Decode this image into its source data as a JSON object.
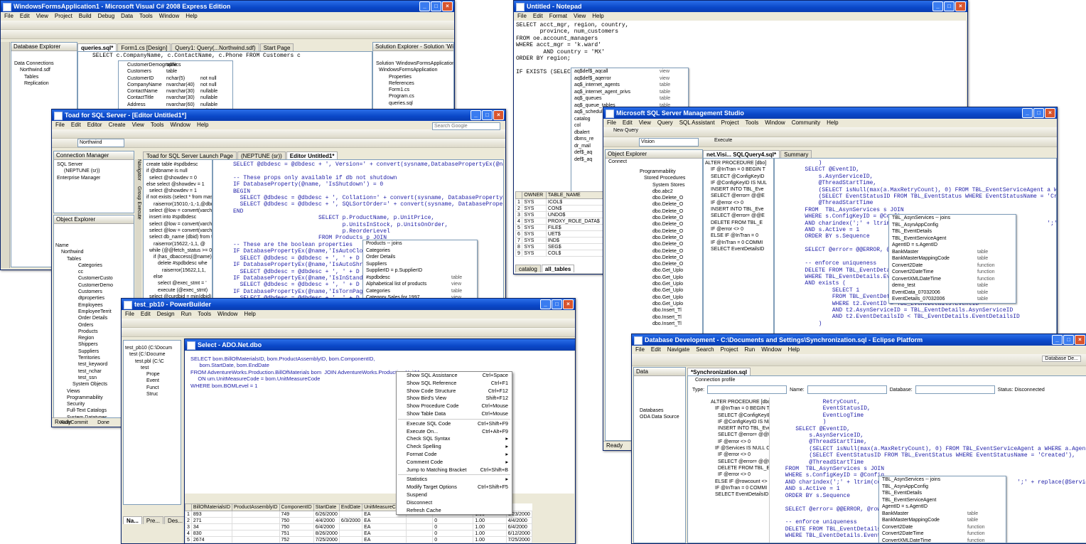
{
  "vs": {
    "title": "WindowsFormsApplication1 - Microsoft Visual C# 2008 Express Edition",
    "menu": [
      "File",
      "Edit",
      "View",
      "Project",
      "Build",
      "Debug",
      "Data",
      "Tools",
      "Window",
      "Help"
    ],
    "db_explorer": {
      "title": "Database Explorer",
      "items": [
        "Data Connections",
        "Northwind.sdf",
        "Tables",
        "Replication"
      ]
    },
    "tabs": [
      "queries.sql*",
      "Form1.cs [Design]",
      "Query1: Query(...Northwind.sdf)",
      "Start Page"
    ],
    "sql": "SELECT c.CompanyName, c.ContactName, c.Phone FROM Customers c",
    "columns": [
      [
        "CustomerDemographics",
        "table"
      ],
      [
        "Customers",
        "table"
      ],
      [
        "CustomerID",
        "nchar(5)",
        "not null"
      ],
      [
        "CompanyName",
        "nvarchar(40)",
        "not null"
      ],
      [
        "ContactName",
        "nvarchar(30)",
        "nullable"
      ],
      [
        "ContactTitle",
        "nvarchar(30)",
        "nullable"
      ],
      [
        "Address",
        "nvarchar(60)",
        "nullable"
      ],
      [
        "City",
        "nvarchar(15)",
        "nullable"
      ]
    ],
    "solution_explorer": {
      "title": "Solution Explorer - Solution 'WindowsFormsApplication1'",
      "items": [
        "Solution 'WindowsFormsApplication'",
        "WindowsFormsApplication",
        "Properties",
        "References",
        "Form1.cs",
        "Program.cs",
        "queries.sql"
      ]
    }
  },
  "notepad": {
    "title": "Untitled - Notepad",
    "menu": [
      "File",
      "Edit",
      "Format",
      "View",
      "Help"
    ],
    "text": "SELECT acct_mgr, region, country,\n       province, num_customers\nFROM oe.account_managers\nWHERE acct_mgr = 'k.ward'\n        AND country = 'MX'\nORDER BY region;\n\nIF EXISTS (SELECT",
    "popup": [
      [
        "aq$def$_aqcall",
        "view"
      ],
      [
        "aq$def$_aqerror",
        "view"
      ],
      [
        "aq$_internet_agents",
        "table"
      ],
      [
        "aq$_internet_agent_privs",
        "table"
      ],
      [
        "aq$_queues",
        "table"
      ],
      [
        "aq$_queue_tables",
        "table"
      ],
      [
        "aq$_schedules",
        "table"
      ],
      [
        "catalog",
        "table"
      ],
      [
        "col",
        "view"
      ],
      [
        "dbalert",
        "view"
      ],
      [
        "dbms_re",
        "view"
      ],
      [
        "dr_mail",
        "view"
      ],
      [
        "def$_aq",
        "view"
      ],
      [
        "def$_aq",
        "view"
      ]
    ],
    "grid_headers": [
      "OWNER",
      "TABLE_NAME"
    ],
    "grid_rows": [
      [
        "1",
        "SYS",
        "ICOL$"
      ],
      [
        "2",
        "SYS",
        "CON$"
      ],
      [
        "3",
        "SYS",
        "UNDO$"
      ],
      [
        "4",
        "SYS",
        "PROXY_ROLE_DATA$"
      ],
      [
        "5",
        "SYS",
        "FILE$"
      ],
      [
        "6",
        "SYS",
        "UET$"
      ],
      [
        "7",
        "SYS",
        "IND$"
      ],
      [
        "8",
        "SYS",
        "SEG$"
      ],
      [
        "9",
        "SYS",
        "COL$"
      ]
    ],
    "bottom_tabs": [
      "catalog",
      "all_tables"
    ]
  },
  "toad": {
    "title": "Toad for SQL Server - [Editor Untitled1*]",
    "menu": [
      "File",
      "Edit",
      "Editor",
      "Create",
      "View",
      "Tools",
      "Window",
      "Help"
    ],
    "search_placeholder": "Search Google",
    "connection_value": "Northwind",
    "conn_manager": {
      "title": "Connection Manager",
      "items": [
        "SQL Server",
        "(NEPTUNE (sr))",
        "Enterprise Manager"
      ]
    },
    "object_explorer": {
      "title": "Object Explorer",
      "items": [
        "Name",
        "Northwind",
        "Tables",
        "Categories",
        "cc",
        "CustomerCusto",
        "CustomerDemo",
        "Customers",
        "dtproperties",
        "Employees",
        "EmployeeTerrit",
        "Order Details",
        "Orders",
        "Products",
        "Region",
        "Shippers",
        "Suppliers",
        "Territories",
        "test_keyword",
        "test_nchar",
        "test_ssn",
        "System Objects",
        "Views",
        "Programmability",
        "Security",
        "Full-Text Catalogs",
        "System Datatypes",
        "pubs2"
      ]
    },
    "tabs": [
      "Toad for SQL Server Launch Page",
      "(NEPTUNE (sr))",
      "Editor Untitled1*"
    ],
    "left_code": [
      "create table #spdbdesc",
      "if @dbname is null",
      "select @showdev = 0",
      "else select @showdev = 1",
      "select @showdev = 1",
      "if not exists (select * from mas",
      "raiserror(15010,-1,-1,@dbna",
      "select @low = convert(varcha",
      "insert into #spdbdesc",
      "select @low = convert(varcha",
      "select @low = convert(varcha",
      "select db_name (dbid) from tt",
      "raiserror(15622,-1,1, @",
      "while (@@fetch_status >= 0",
      "if (has_dbaccess(@name)",
      "delete #spdbdesc whe",
      "raiserror(15622,1,1,",
      "else",
      "select @exec_stmt = '",
      "execute (@exec_stmt)",
      "select @curdbid = min(dbid) f",
      "while @curdbid IS NOT NULL"
    ],
    "code": "SELECT @dbdesc = @dbdesc + ', Version=' + convert(sysname,DatabasePropertyEx(@name,'V\n\n-- These props only available if db not shutdown\nIF DatabaseProperty(@name, 'IsShutdown') = 0\nBEGIN\n  SELECT @dbdesc = @dbdesc + ', Collation=' + convert(sysname, DatabasePropertyEx(@name\n  SELECT @dbdesc = @dbdesc + ', SQLSortOrder=' + convert(sysname, DatabasePropertyEx(@na\nEND\n                         SELECT p.ProductName, p.UnitPrice,\n                                p.UnitsInStock, p.UnitsOnOrder,\n                                p.ReorderLevel\n                         FROM Products p JOIN\n-- These are the boolean properties\nIF DatabasePropertyEx(@name,'IsAutoClo\n  SELECT @dbdesc = @dbdesc + ', ' + D\nIF DatabasePropertyEx(@name,'IsAutoShr\n  SELECT @dbdesc = @dbdesc + ', ' + D\nIF DatabasePropertyEx(@name,'IsInStand\n  SELECT @dbdesc = @dbdesc + ', ' + D\nIF DatabasePropertyEx(@name,'IsTornPag\n  SELECT @dbdesc = @dbdesc + ', ' + D",
    "popup": [
      [
        "Products -- joins",
        ""
      ],
      [
        "Categories",
        ""
      ],
      [
        "Order Details",
        ""
      ],
      [
        "Suppliers",
        ""
      ],
      [
        "SupplierID = p.SupplierID",
        ""
      ],
      [
        "#spdbdesc",
        "table"
      ],
      [
        "Alphabetical list of products",
        "view"
      ],
      [
        "Categories",
        "table"
      ],
      [
        "Category Sales for 1997",
        "view"
      ]
    ],
    "status": "Ready",
    "bottom": [
      "AutoCommit",
      "Done"
    ],
    "sidebar_tabs": [
      "Navigator",
      "Group Execute"
    ]
  },
  "ssms": {
    "title": "Microsoft SQL Server Management Studio",
    "menu": [
      "File",
      "Edit",
      "View",
      "Query",
      "SQL Assistant",
      "Project",
      "Tools",
      "Window",
      "Community",
      "Help"
    ],
    "new_query": "New Query",
    "db_value": "Vision",
    "execute": "Execute",
    "obj_explorer": {
      "title": "Object Explorer",
      "connect": "Connect",
      "items": [
        "Programmability",
        "Stored Procedures",
        "System Stores",
        "dbo.abc2",
        "dbo.Delete_O",
        "dbo.Delete_O",
        "dbo.Delete_O",
        "dbo.Delete_O",
        "dbo.Delete_O",
        "dbo.Delete_O",
        "dbo.Delete_O",
        "dbo.Delete_O",
        "dbo.Delete_O",
        "dbo.Delete_O",
        "dbo.Delete_O",
        "dbo.Get_Uplo",
        "dbo.Get_Uplo",
        "dbo.Get_Uplo",
        "dbo.Get_Uplo",
        "dbo.Get_Uplo",
        "dbo.Get_Uplo",
        "dbo.Insert_Tl",
        "dbo.Insert_Tl",
        "dbo.Insert_Tl"
      ]
    },
    "tabs": [
      "net.Visi... SQLQuery4.sql*",
      "Summary"
    ],
    "outline": [
      "ALTER PROCEDURE [dbo]",
      "IF @InTran = 0 BEGIN T",
      "SELECT @ConfigKeyID",
      "IF @ConfigKeyID IS NUL",
      "INSERT INTO TBL_Eve",
      "SELECT @error= @@E",
      "IF @error <> 0",
      "INSERT INTO TBL_Eve",
      "SELECT @error= @@E",
      "DELETE FROM TBL_E",
      "IF @error <> 0",
      "ELSE IF @InTran = 0",
      "IF @InTran = 0 COMMI",
      "SELECT EventDetailsID"
    ],
    "code": "            )\n        SELECT @EventID,\n            s.AsynServiceID,\n            @ThreadStartTime,\n            (SELECT isNull(max(a.MaxRetryCount), 0) FROM TBL_EventServiceAgent a WHERE\n            (SELECT EventStatusID FROM TBL_EventStatus WHERE EventStatusName = 'Create\n            @ThreadStartTime\n        FROM  TBL_AsynServices s JOIN\n        WHERE s.ConfigKeyID = @Config\n        AND charindex(';' + ltrim(con                                          ';' + rep\n        AND s.Active = 1\n        ORDER BY s.Sequence\n\n        SELECT @error= @@ERROR, @rowc\n\n        -- enforce uniqueness\n        DELETE FROM TBL_EventDetails\n        WHERE TBL_EventDetails.Event\n        AND exists (\n                SELECT 1\n                FROM TBL_EventDetails\n                WHERE t2.EventID = TBL_EventDetails.EventID\n                AND t2.AsynServiceID = TBL_EventDetails.AsynServiceID\n                AND t2.EventDetailsID < TBL_EventDetails.EventDetailsID\n            )",
    "popup": [
      [
        "TBL_AsynServices -- joins",
        ""
      ],
      [
        "TBL_AsynAppConfig",
        ""
      ],
      [
        "TBL_EventDetails",
        ""
      ],
      [
        "TBL_EventServiceAgent",
        ""
      ],
      [
        "AgentID = s.AgentID",
        ""
      ],
      [
        "BankMaster",
        "table"
      ],
      [
        "BankMasterMappingCode",
        "table"
      ],
      [
        "Convert2Date",
        "function"
      ],
      [
        "Convert2DateTime",
        "function"
      ],
      [
        "ConvertXMLDateTime",
        "function"
      ],
      [
        "demo_test",
        "table"
      ],
      [
        "EventData_07032006",
        "table"
      ],
      [
        "EventDetails_07032006",
        "table"
      ]
    ],
    "status": "Ready"
  },
  "pb": {
    "title": "test_pb10 - PowerBuilder",
    "menu": [
      "File",
      "Edit",
      "Design",
      "Run",
      "Tools",
      "Window",
      "Help"
    ],
    "tree": [
      "test_pb10 (C:\\Docum",
      "test (C:\\Docume",
      "test.pbl (C:\\C",
      "test",
      "Prope",
      "Event",
      "Funct",
      "Struc"
    ],
    "bottom_tabs": [
      "Na...",
      "Pre...",
      "Des..."
    ],
    "select": {
      "title": "Select - ADO.Net.dbo",
      "code": "SELECT bom.BillOfMaterialsID, bom.ProductAssemblyID, bom.ComponentID,\n      bom.StartDate, bom.EndDate\nFROM AdventureWorks.Production.BillOfMaterials bom  JOIN AdventureWorks.Production.UnitMeasure um\n     ON um.UnitMeasureCode = bom.UnitMeasureCode\nWHERE bom.BOMLevel = 1",
      "grid_headers": [
        "BillOfMaterialsID",
        "ProductAssemblyID",
        "ComponentID",
        "StartDate",
        "EndDate",
        "UnitMeasureCode",
        "BOMLevel",
        "PerAssemblyQty",
        "ModifiedDate"
      ],
      "grid_rows": [
        [
          "1",
          "893",
          "",
          "749",
          "6/26/2000",
          "",
          "EA",
          "",
          "",
          "1.00",
          "6/23/2000"
        ],
        [
          "2",
          "271",
          "",
          "750",
          "4/4/2000",
          "6/3/2000",
          "EA",
          "",
          "0",
          "1.00",
          "4/4/2000"
        ],
        [
          "3",
          "34",
          "",
          "750",
          "6/4/2000",
          "",
          "EA",
          "",
          "0",
          "1.00",
          "6/4/2000"
        ],
        [
          "4",
          "830",
          "",
          "751",
          "8/26/2000",
          "",
          "EA",
          "",
          "0",
          "1.00",
          "6/12/2000"
        ],
        [
          "5",
          "2674",
          "",
          "752",
          "7/25/2000",
          "",
          "EA",
          "",
          "0",
          "1.00",
          "7/25/2000"
        ]
      ]
    },
    "context_menu": [
      [
        "Show SQL Assistance",
        "Ctrl+Space"
      ],
      [
        "Show SQL Reference",
        "Ctrl+F1"
      ],
      [
        "Show Code Structure",
        "Ctrl+F12"
      ],
      [
        "Show Bird's View",
        "Shift+F12"
      ],
      [
        "Show Procedure Code",
        "Ctrl+Mouse"
      ],
      [
        "Show Table Data",
        "Ctrl+Mouse"
      ],
      null,
      [
        "Execute SQL Code",
        "Ctrl+Shift+F9"
      ],
      [
        "Execute On...",
        "Ctrl+Alt+F9"
      ],
      [
        "Check SQL Syntax",
        "▸"
      ],
      [
        "Check Spelling",
        "▸"
      ],
      [
        "Format Code",
        "▸"
      ],
      [
        "Comment Code",
        "▸"
      ],
      [
        "Jump to Matching Bracket",
        "Ctrl+Shift+B"
      ],
      null,
      [
        "Statistics",
        "▸"
      ],
      [
        "Modify Target Options",
        "Ctrl+Shift+F5"
      ],
      [
        "Suspend",
        ""
      ],
      [
        "Disconnect",
        ""
      ],
      [
        "Refresh Cache",
        ""
      ]
    ]
  },
  "eclipse": {
    "title": "Database Development - C:\\Documents and Settings\\Synchronization.sql - Eclipse Platform",
    "menu": [
      "File",
      "Edit",
      "Navigate",
      "Search",
      "Project",
      "Run",
      "Window",
      "Help"
    ],
    "perspective": "Database De...",
    "data_tab": "Data",
    "tree": [
      "Databases",
      "ODA Data Source"
    ],
    "editor_tab": "*Synchronization.sql",
    "conn_profile": "Connection profile",
    "labels": {
      "type": "Type:",
      "name": "Name:",
      "database": "Database:",
      "status": "Status: Disconnected"
    },
    "outline": [
      "ALTER PROCEDURE [dbo]",
      "IF @InTran = 0 BEGIN T",
      "SELECT @ConfigKeyID",
      "IF @ConfigKeyID IS NUL",
      "INSERT INTO TBL_Eve",
      "SELECT @error= @@E",
      "IF @error <> 0",
      "IF @Services IS NULL C",
      "IF @error <> 0",
      "SELECT @error= @@E",
      "DELETE FROM TBL_E",
      "IF @error <> 0",
      "ELSE IF @rowcount <>",
      "IF @InTran = 0 COMMI",
      "SELECT EventDetailsID"
    ],
    "code": "            RetryCount,\n            EventStatusID,\n            EventLogTime\n            )\n    SELECT @EventID,\n        s.AsynServiceID,\n        @ThreadStartTime,\n        (SELECT isNull(max(a.MaxRetryCount), 0) FROM TBL_EventServiceAgent a WHERE a.AgentID = s\n        (SELECT EventStatusID FROM TBL_EventStatus WHERE EventStatusName = 'Created'),\n        @ThreadStartTime\n FROM  TBL_AsynServices s JOIN\n WHERE s.ConfigKeyID = @Config\n AND charindex(';' + ltrim(conv                                      ';' + replace(@Services,\n AND s.Active = 1\n ORDER BY s.Sequence\n\n SELECT @error= @@ERROR, @rowco\n\n -- enforce uniqueness\n DELETE FROM TBL_EventDetails\n WHERE TBL_EventDetails.EventID",
    "popup": [
      [
        "TBL_AsynServices -- joins",
        ""
      ],
      [
        "TBL_AsynAppConfig",
        ""
      ],
      [
        "TBL_EventDetails",
        ""
      ],
      [
        "TBL_EventServiceAgent",
        ""
      ],
      [
        "AgentID = s.AgentID",
        ""
      ],
      [
        "BankMaster",
        "table"
      ],
      [
        "BankMasterMappingCode",
        "table"
      ],
      [
        "Convert2Date",
        "function"
      ],
      [
        "Convert2DateTime",
        "function"
      ],
      [
        "ConvertXMLDateTime",
        "function"
      ],
      [
        "demo_test",
        "table"
      ]
    ]
  }
}
